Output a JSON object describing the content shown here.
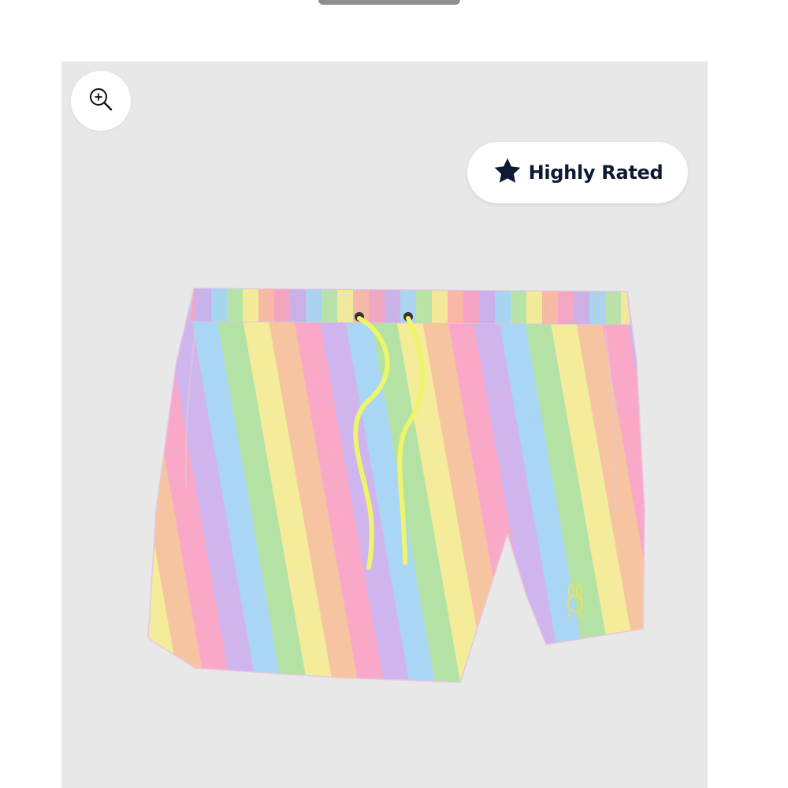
{
  "product": {
    "badge": {
      "icon": "star-icon",
      "label": "Highly Rated"
    },
    "zoom": {
      "icon": "zoom-in-icon"
    },
    "image": {
      "subject": "rainbow-chevron-swim-shorts",
      "colors": [
        "#f7a8c8",
        "#c8a8ec",
        "#a8dcf4",
        "#b8e6a8",
        "#f4ec98",
        "#f8c8a0"
      ]
    }
  },
  "colors": {
    "panel_background": "#e8e8e8",
    "badge_text": "#0e1a33",
    "drawstring": "#eef56a"
  }
}
